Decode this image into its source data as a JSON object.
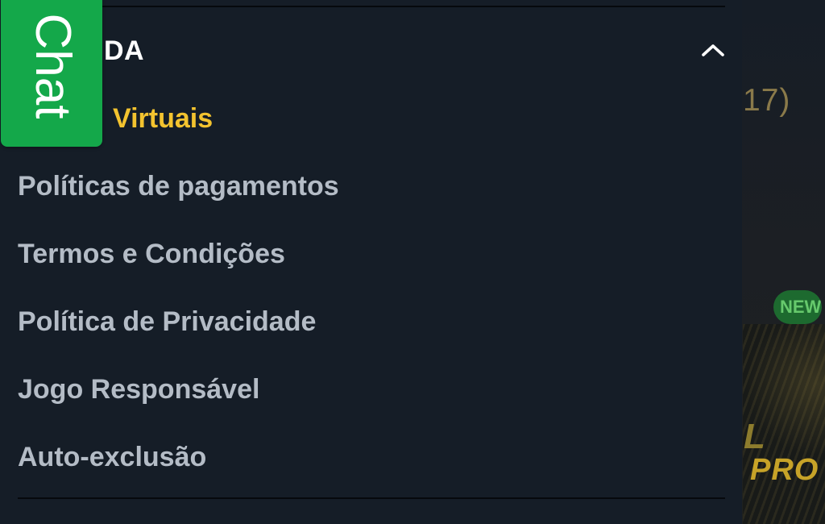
{
  "background": {
    "partial_count": "17)",
    "badge": "NEW",
    "promo_line_1": "L",
    "promo_line_2": "PRO"
  },
  "drawer": {
    "section_title": "DA",
    "collapse_icon": "chevron-up-icon",
    "items": [
      {
        "label": "Virtuais",
        "active": true
      },
      {
        "label": "Políticas de pagamentos",
        "active": false
      },
      {
        "label": "Termos e Condições",
        "active": false
      },
      {
        "label": "Política de Privacidade",
        "active": false
      },
      {
        "label": "Jogo Responsável",
        "active": false
      },
      {
        "label": "Auto-exclusão",
        "active": false
      }
    ]
  },
  "chat": {
    "label": "Chat"
  },
  "colors": {
    "drawer_background": "#151d27",
    "active_item": "#f3c32f",
    "menu_text": "#b4bcc6",
    "chat_green": "#14a84a",
    "divider": "#06090d"
  }
}
